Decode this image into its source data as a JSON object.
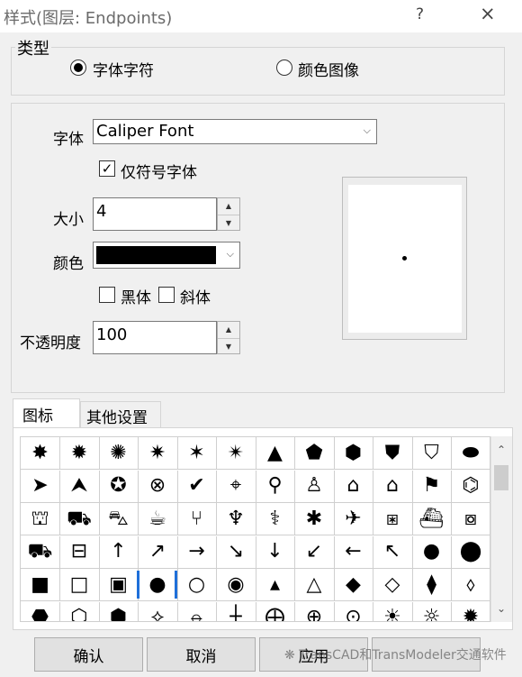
{
  "window": {
    "title": "样式(图层: Endpoints)",
    "help_icon": "?",
    "close_icon": "×"
  },
  "type_group": {
    "label": "类型",
    "option_font": "字体字符",
    "option_image": "颜色图像",
    "selected": "字体字符"
  },
  "font": {
    "label": "字体",
    "value": "Caliper Font",
    "symbol_only_label": "仅符号字体",
    "symbol_only_checked": true
  },
  "size": {
    "label": "大小",
    "value": "4"
  },
  "color": {
    "label": "颜色",
    "value": "#000000"
  },
  "bold_label": "黑体",
  "italic_label": "斜体",
  "opacity": {
    "label": "不透明度",
    "value": "100"
  },
  "tabs": [
    {
      "label": "图标",
      "active": true
    },
    {
      "label": "其他设置",
      "active": false
    }
  ],
  "icons": [
    [
      "badge-8point",
      "badge-10point",
      "badge-12point",
      "badge-14point",
      "badge-16point",
      "badge-18point",
      "triangle-filled",
      "pentagon-filled",
      "hexagon-filled",
      "shield-filled",
      "chevron-shield-filled",
      "pill-filled"
    ],
    [
      "navigation-arrow",
      "compass-north",
      "star-circle",
      "x-circle",
      "check-circle",
      "crosshair-target",
      "pushpin",
      "person",
      "house-filled",
      "house-outline",
      "flag",
      "graduation-cap"
    ],
    [
      "museum",
      "shopping-bag",
      "shopping-cart",
      "coffee-cup",
      "fork-knife",
      "wine-glass",
      "pharmacy",
      "asterisk-flower",
      "airplane",
      "airport-box",
      "train",
      "train-box"
    ],
    [
      "bus",
      "bus-box",
      "arrow-up",
      "arrow-up-right",
      "arrow-right",
      "arrow-down-right",
      "arrow-down",
      "arrow-down-left",
      "arrow-left",
      "arrow-up-left",
      "circle-filled",
      "circle-filled-large"
    ],
    [
      "square-filled",
      "square-outline",
      "square-dot",
      "circle-filled-selected",
      "circle-outline",
      "circle-dot",
      "triangle-small-filled",
      "triangle-small-outline",
      "diamond-filled",
      "diamond-outline",
      "diamond-narrow-filled",
      "diamond-narrow-outline"
    ],
    [
      "hexagon-black",
      "hexagon-outline",
      "hexagon-flat",
      "diamond-cross",
      "circle-line",
      "plus-cross",
      "circle-crosshair",
      "circle-cross-plus",
      "circle-dot-cross",
      "sun-filled",
      "sun-outline",
      "sun-rays"
    ]
  ],
  "selected_icon": "circle-filled-selected",
  "buttons": {
    "ok": "确认",
    "cancel": "取消",
    "apply": "应用"
  },
  "watermark": "TransCAD和TransModeler交通软件"
}
